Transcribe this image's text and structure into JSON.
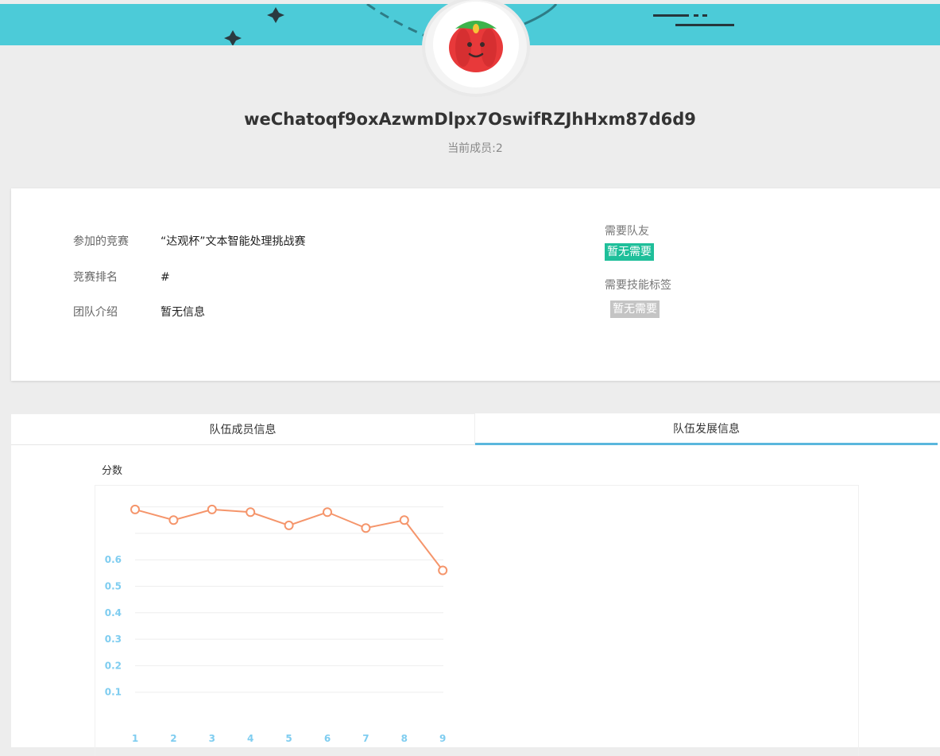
{
  "team": {
    "name": "weChatoqf9oxAzwmDlpx7OswifRZJhHxm87d6d9",
    "member_count": "当前成员:2"
  },
  "info": {
    "competition_label": "参加的竞赛",
    "competition_value": "“达观杯”文本智能处理挑战赛",
    "rank_label": "竞赛排名",
    "rank_value": "#",
    "intro_label": "团队介绍",
    "intro_value": "暂无信息",
    "need_teammate_label": "需要队友",
    "need_teammate_tag": "暂无需要",
    "need_skill_label": "需要技能标签",
    "need_skill_tag": "暂无需要"
  },
  "tabs": {
    "members": "队伍成员信息",
    "development": "队伍发展信息"
  },
  "colors": {
    "banner": "#4ccbd8",
    "line": "#f5956b",
    "axis_text": "#7fcdf0",
    "tag_green": "#1fbf9a",
    "tag_gray": "#c4c4c4",
    "tab_active": "#5ab7dd"
  },
  "chart_data": {
    "type": "line",
    "ylabel": "分数",
    "x": [
      "1",
      "2",
      "3",
      "4",
      "5",
      "6",
      "7",
      "8",
      "9"
    ],
    "series": [
      {
        "values": [
          0.79,
          0.75,
          0.79,
          0.78,
          0.73,
          0.78,
          0.72,
          0.75,
          0.56
        ]
      }
    ],
    "yticks": [
      "0.1",
      "0.2",
      "0.3",
      "0.4",
      "0.5",
      "0.6"
    ],
    "ylim": [
      0,
      0.9
    ],
    "grid": true
  }
}
